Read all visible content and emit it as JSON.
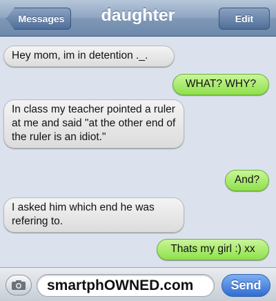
{
  "header": {
    "title": "daughter",
    "back_label": "Messages",
    "edit_label": "Edit"
  },
  "messages": [
    {
      "direction": "incoming",
      "text": "Hey mom, im in detention ._."
    },
    {
      "direction": "outgoing",
      "text": "WHAT? WHY?"
    },
    {
      "direction": "incoming",
      "text": "In class my teacher pointed a ruler at me and said \"at the other end of the ruler is an idiot.\""
    },
    {
      "direction": "outgoing",
      "text": "And?"
    },
    {
      "direction": "incoming",
      "text": "I asked him which end he was refering to."
    },
    {
      "direction": "outgoing",
      "text": "Thats my girl :) xx"
    }
  ],
  "composer": {
    "input_value": "smartphOWNED.com",
    "send_label": "Send",
    "camera_icon": "camera-icon"
  },
  "colors": {
    "incoming_bubble": "#e6e6e6",
    "outgoing_bubble": "#a7ea6a",
    "send_button": "#3b7bd9",
    "nav_bar": "#8ea4c0"
  }
}
